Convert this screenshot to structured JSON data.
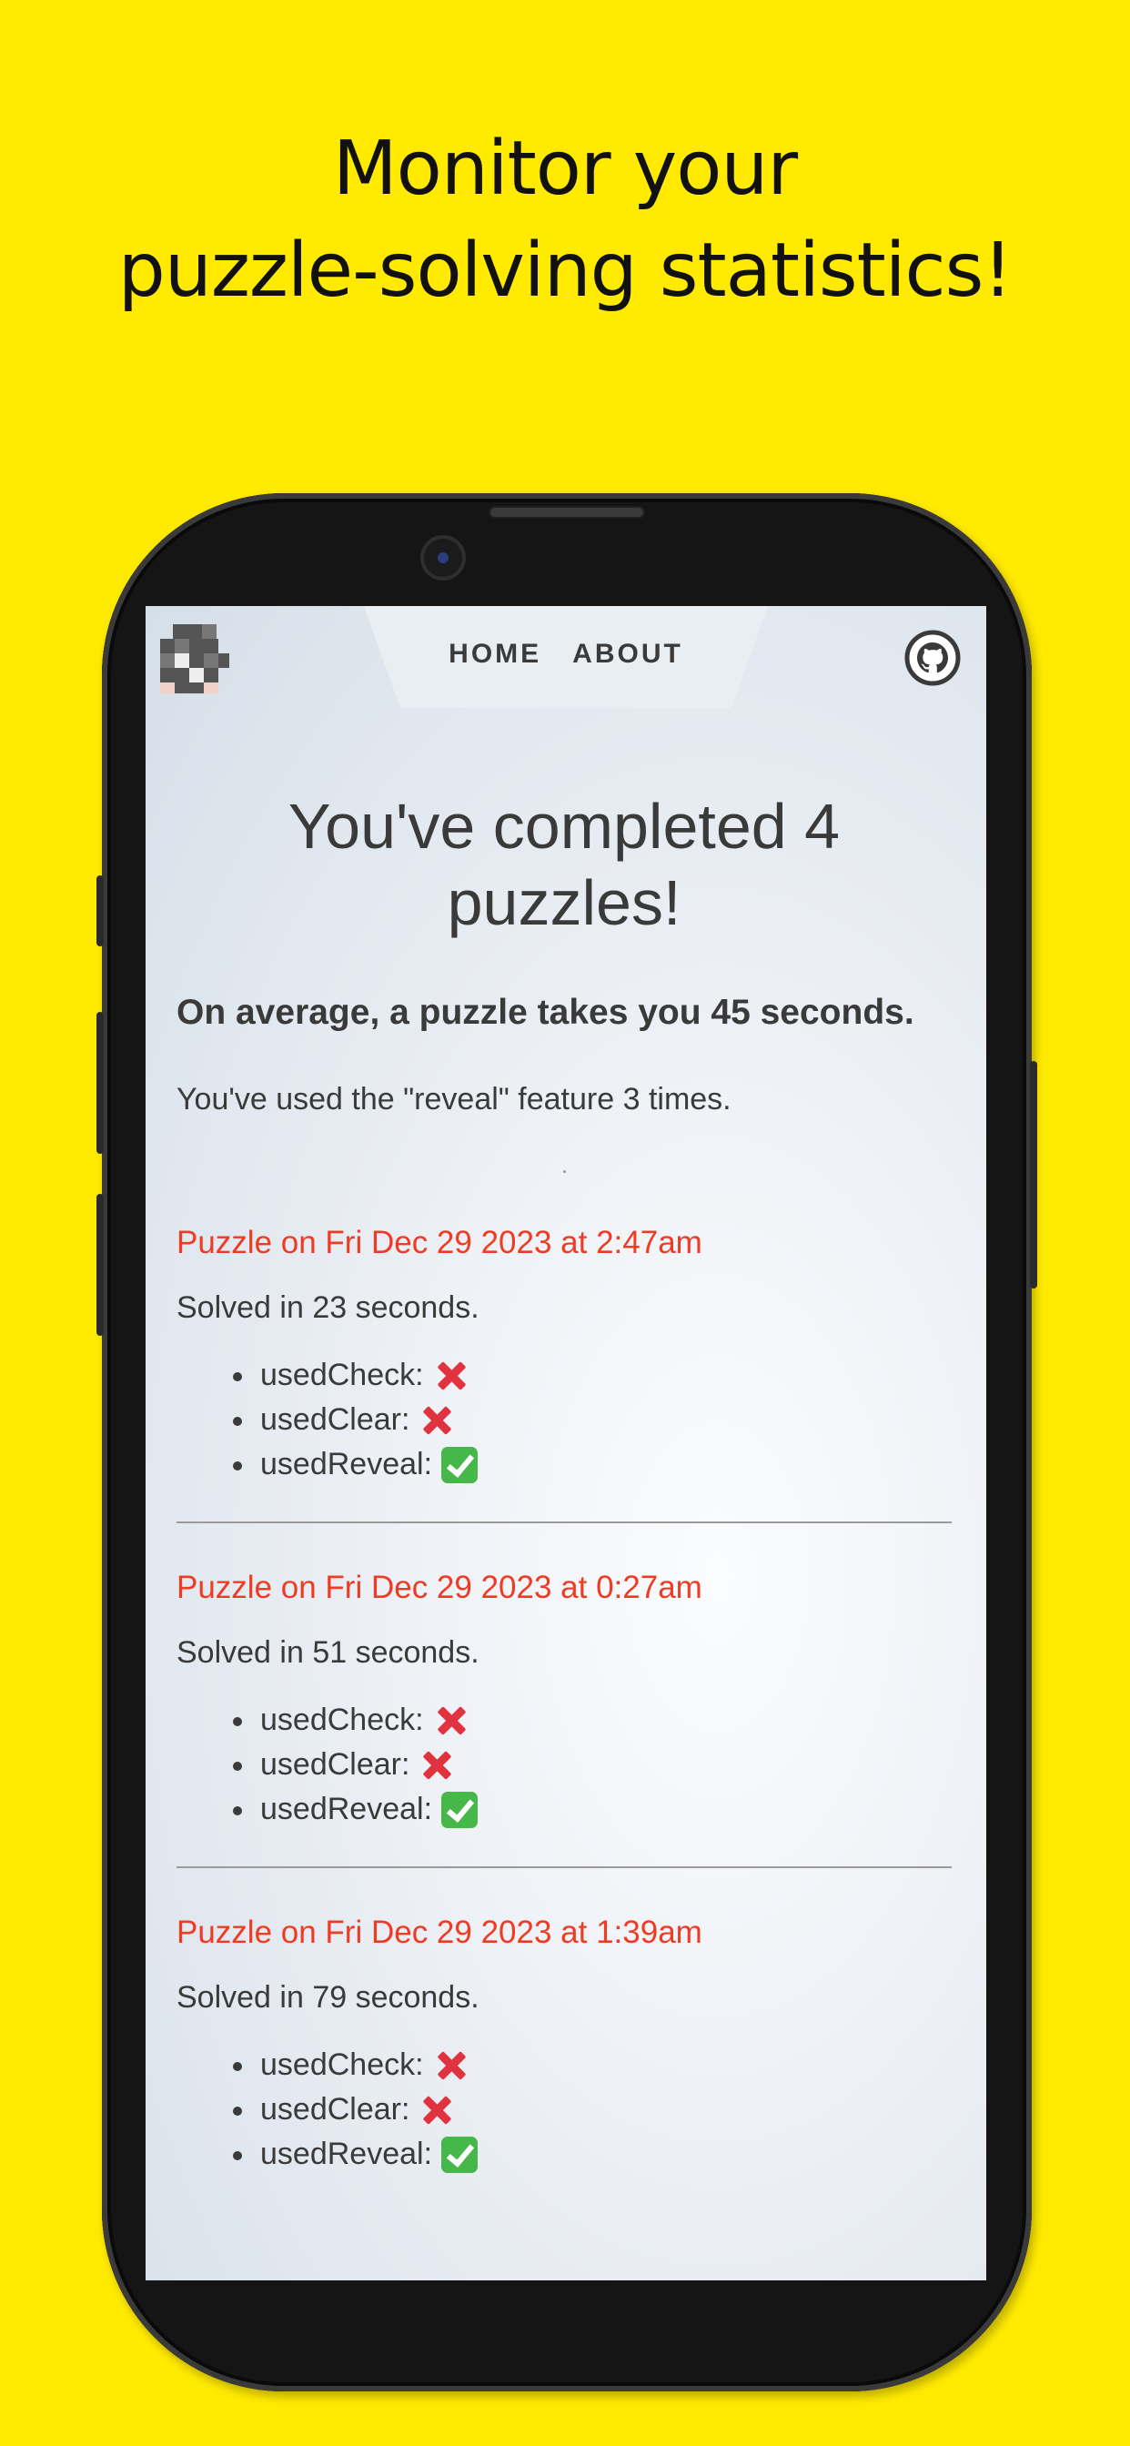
{
  "promo": {
    "line1": "Monitor your",
    "line2": "puzzle-solving statistics!"
  },
  "nav": {
    "home": "HOME",
    "about": "ABOUT"
  },
  "stats": {
    "headline_line1": "You've completed 4",
    "headline_line2": "puzzles!",
    "average": "On average, a puzzle takes you 45 seconds.",
    "reveal_usage": "You've used the \"reveal\" feature 3 times."
  },
  "puzzles": [
    {
      "title": "Puzzle on Fri Dec 29 2023 at 2:47am",
      "solved": "Solved in 23 seconds.",
      "flags": [
        {
          "label": "usedCheck:",
          "value": false
        },
        {
          "label": "usedClear:",
          "value": false
        },
        {
          "label": "usedReveal:",
          "value": true
        }
      ]
    },
    {
      "title": "Puzzle on Fri Dec 29 2023 at 0:27am",
      "solved": "Solved in 51 seconds.",
      "flags": [
        {
          "label": "usedCheck:",
          "value": false
        },
        {
          "label": "usedClear:",
          "value": false
        },
        {
          "label": "usedReveal:",
          "value": true
        }
      ]
    },
    {
      "title": "Puzzle on Fri Dec 29 2023 at 1:39am",
      "solved": "Solved in 79 seconds.",
      "flags": [
        {
          "label": "usedCheck:",
          "value": false
        },
        {
          "label": "usedClear:",
          "value": false
        },
        {
          "label": "usedReveal:",
          "value": true
        }
      ]
    }
  ],
  "icons": {
    "logo": "crossword-grid-logo-icon",
    "github": "github-icon",
    "false_flag": "cross-mark-icon",
    "true_flag": "check-mark-icon"
  },
  "colors": {
    "background": "#ffea00",
    "puzzle_title": "#ef3b24",
    "cross": "#e0323f",
    "check": "#46b749"
  }
}
